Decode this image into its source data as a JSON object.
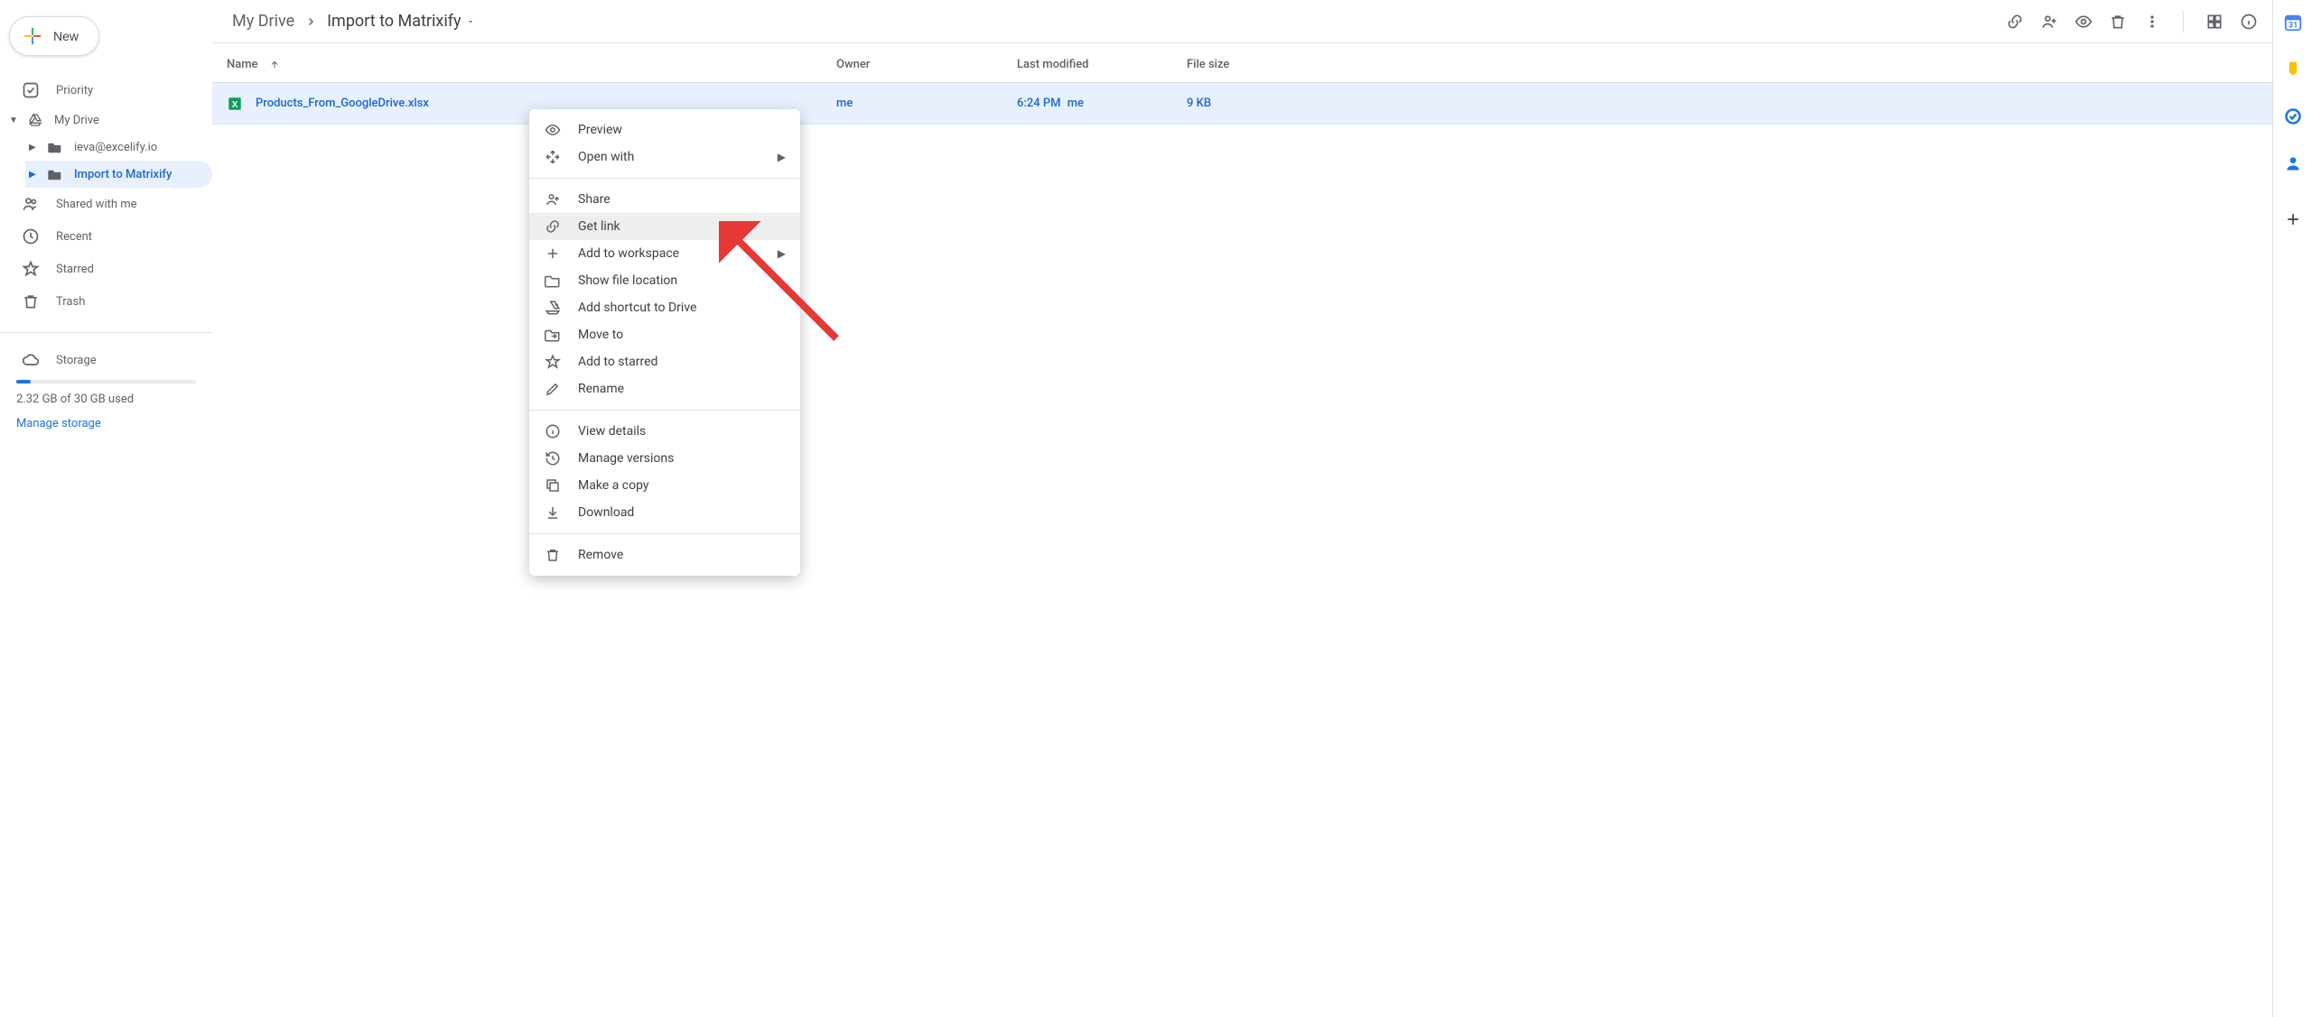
{
  "sidebar": {
    "new_label": "New",
    "priority": "Priority",
    "my_drive": "My Drive",
    "tree": {
      "email": "ieva@excelify.io",
      "import_matrixify": "Import to Matrixify"
    },
    "shared": "Shared with me",
    "recent": "Recent",
    "starred": "Starred",
    "trash": "Trash",
    "storage_label": "Storage",
    "storage_text": "2.32 GB of 30 GB used",
    "manage": "Manage storage"
  },
  "breadcrumbs": {
    "root": "My Drive",
    "current": "Import to Matrixify"
  },
  "columns": {
    "name": "Name",
    "owner": "Owner",
    "modified": "Last modified",
    "size": "File size"
  },
  "file": {
    "name": "Products_From_GoogleDrive.xlsx",
    "owner": "me",
    "modified_time": "6:24 PM",
    "modified_by": "me",
    "size": "9 KB"
  },
  "context_menu": {
    "preview": "Preview",
    "open_with": "Open with",
    "share": "Share",
    "get_link": "Get link",
    "add_workspace": "Add to workspace",
    "show_location": "Show file location",
    "add_shortcut": "Add shortcut to Drive",
    "move_to": "Move to",
    "add_starred": "Add to starred",
    "rename": "Rename",
    "view_details": "View details",
    "manage_versions": "Manage versions",
    "make_copy": "Make a copy",
    "download": "Download",
    "remove": "Remove"
  }
}
